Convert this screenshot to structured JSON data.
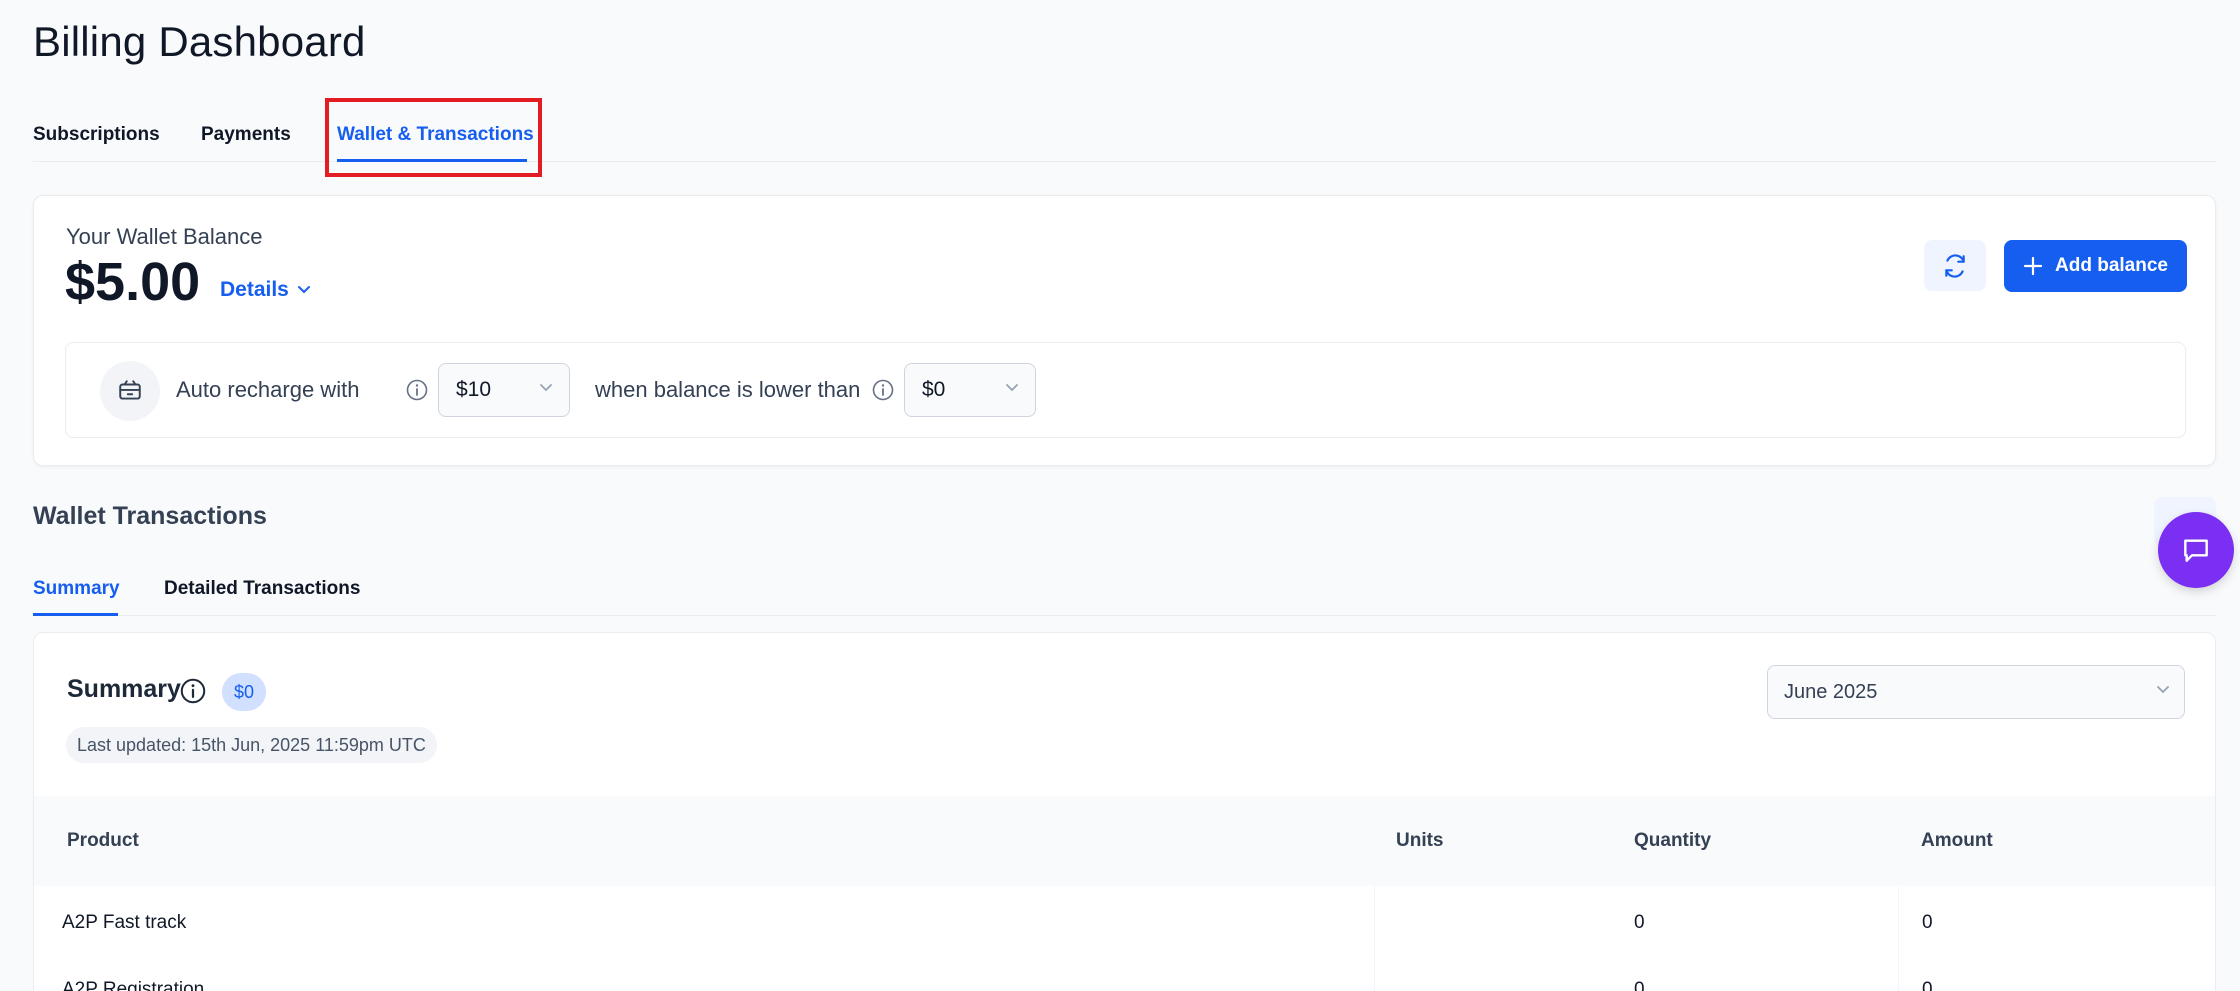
{
  "page": {
    "title": "Billing Dashboard"
  },
  "tabs": [
    {
      "label": "Subscriptions"
    },
    {
      "label": "Payments"
    },
    {
      "label": "Wallet & Transactions",
      "active": true
    }
  ],
  "wallet": {
    "label": "Your Wallet Balance",
    "amount": "$5.00",
    "details_label": "Details",
    "add_balance_label": "Add balance",
    "auto_recharge_label": "Auto recharge with",
    "recharge_amount": "$10",
    "threshold_label": "when balance is lower than",
    "threshold_amount": "$0"
  },
  "transactions": {
    "title": "Wallet Transactions",
    "subtabs": [
      {
        "label": "Summary",
        "active": true
      },
      {
        "label": "Detailed Transactions"
      }
    ]
  },
  "summary": {
    "title": "Summary",
    "badge": "$0",
    "last_updated": "Last updated: 15th Jun, 2025 11:59pm UTC",
    "month": "June 2025",
    "columns": [
      "Product",
      "Units",
      "Quantity",
      "Amount"
    ],
    "rows": [
      {
        "product": "A2P Fast track",
        "units": "",
        "quantity": "0",
        "amount": "0"
      },
      {
        "product": "A2P Registration",
        "units": "",
        "quantity": "0",
        "amount": "0"
      }
    ]
  },
  "colors": {
    "primary": "#155eef",
    "highlight": "#e31b23",
    "chat": "#7a2ff2"
  },
  "icons": [
    "refresh-icon",
    "plus-icon",
    "chevron-down-icon",
    "info-icon",
    "recharge-icon",
    "chat-icon"
  ]
}
